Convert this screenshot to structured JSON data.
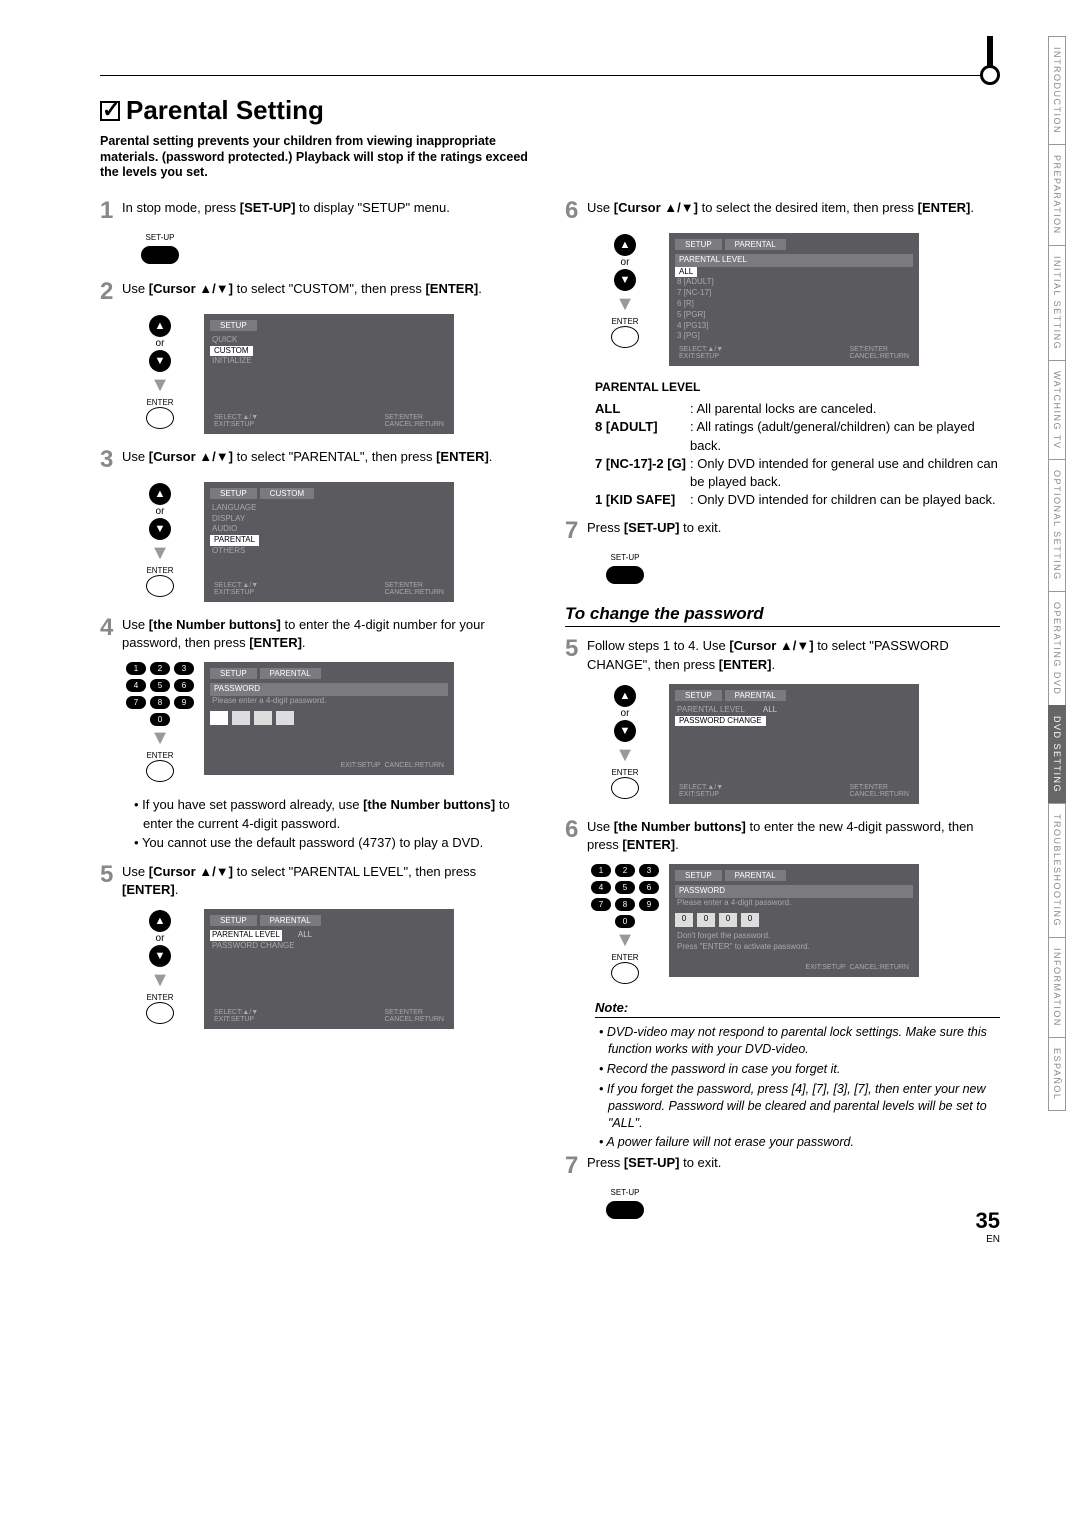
{
  "title": "Parental Setting",
  "intro": "Parental setting prevents your children from viewing inappropriate materials. (password protected.) Playback will stop if the ratings exceed the levels you set.",
  "steps_left": {
    "s1": "In stop mode, press [SET-UP] to display \"SETUP\" menu.",
    "s1_label": "SET-UP",
    "s2_a": "Use ",
    "s2_b": "[Cursor ▲/▼]",
    "s2_c": " to select \"CUSTOM\", then press ",
    "s2_d": "[ENTER]",
    "s2_e": ".",
    "s3_a": "Use ",
    "s3_b": "[Cursor ▲/▼]",
    "s3_c": " to select \"PARENTAL\", then press ",
    "s3_d": "[ENTER]",
    "s3_e": ".",
    "s4_a": "Use ",
    "s4_b": "[the Number buttons]",
    "s4_c": " to enter the 4-digit number for your password, then press ",
    "s4_d": "[ENTER]",
    "s4_e": ".",
    "s5_a": "Use ",
    "s5_b": "[Cursor ▲/▼]",
    "s5_c": " to select \"PARENTAL LEVEL\", then press ",
    "s5_d": "[ENTER]",
    "s5_e": "."
  },
  "bullets_left": {
    "b1_a": "If you have set password already, use ",
    "b1_b": "[the Number buttons]",
    "b1_c": " to enter the current 4-digit password.",
    "b2": "You cannot use the default password (4737) to play a DVD."
  },
  "steps_right": {
    "s6_a": "Use ",
    "s6_b": "[Cursor ▲/▼]",
    "s6_c": " to select the desired item, then press ",
    "s6_d": "[ENTER]",
    "s6_e": ".",
    "s7_a": "Press ",
    "s7_b": "[SET-UP]",
    "s7_c": " to exit.",
    "s7_label": "SET-UP"
  },
  "parental_level": {
    "head": "PARENTAL LEVEL",
    "rows": [
      {
        "k": "ALL",
        "v": ": All parental locks are canceled."
      },
      {
        "k": "8 [ADULT]",
        "v": ": All ratings (adult/general/children) can be played back."
      },
      {
        "k": "7 [NC-17]-2 [G]",
        "v": ": Only DVD intended for general use and children can be played back."
      },
      {
        "k": "1 [KID SAFE]",
        "v": ": Only DVD intended for children can be played back."
      }
    ]
  },
  "change_pw": {
    "title": "To change the password",
    "s5_a": "Follow steps 1 to 4. Use ",
    "s5_b": "[Cursor ▲/▼]",
    "s5_c": " to select \"PASSWORD CHANGE\", then press ",
    "s5_d": "[ENTER]",
    "s5_e": ".",
    "s6_a": "Use ",
    "s6_b": "[the Number buttons]",
    "s6_c": " to enter the new 4-digit password, then press ",
    "s6_d": "[ENTER]",
    "s6_e": ".",
    "s7_a": "Press ",
    "s7_b": "[SET-UP]",
    "s7_c": " to exit.",
    "s7_label": "SET-UP"
  },
  "note": {
    "head": "Note:",
    "items": [
      "DVD-video may not respond to parental lock settings. Make sure this function works with your DVD-video.",
      "Record the password in case you forget it.",
      "If you forget the password, press [4], [7], [3], [7], then enter your new password. Password will be cleared and parental levels will be set to \"ALL\".",
      "A power failure will not erase your password."
    ]
  },
  "osd": {
    "setup": "SETUP",
    "custom": "CUSTOM",
    "parental": "PARENTAL",
    "quick": "QUICK",
    "custom_item": "CUSTOM",
    "initialize": "INITIALIZE",
    "language": "LANGUAGE",
    "display": "DISPLAY",
    "audio": "AUDIO",
    "parental_item": "PARENTAL",
    "others": "OTHERS",
    "password": "PASSWORD",
    "pw_prompt": "Please enter a 4-digit password.",
    "parental_level": "PARENTAL LEVEL",
    "all": "ALL",
    "password_change": "PASSWORD CHANGE",
    "levels": [
      "ALL",
      "8 [ADULT]",
      "7 [NC-17]",
      "6 [R]",
      "5 [PGR]",
      "4 [PG13]",
      "3 [PG]"
    ],
    "dont_forget": "Don't forget the password.",
    "press_enter_activate": "Press \"ENTER\" to activate password.",
    "footer_select": "SELECT:▲/▼",
    "footer_set": "SET:ENTER",
    "footer_exit": "EXIT:SETUP",
    "footer_cancel": "CANCEL:RETURN",
    "enter_label": "ENTER",
    "or": "or",
    "zero": "0"
  },
  "side_tabs": [
    "INTRODUCTION",
    "PREPARATION",
    "INITIAL SETTING",
    "WATCHING TV",
    "OPTIONAL SETTING",
    "OPERATING DVD",
    "DVD SETTING",
    "TROUBLESHOOTING",
    "INFORMATION",
    "ESPAÑOL"
  ],
  "page_num": "35",
  "page_lang": "EN"
}
